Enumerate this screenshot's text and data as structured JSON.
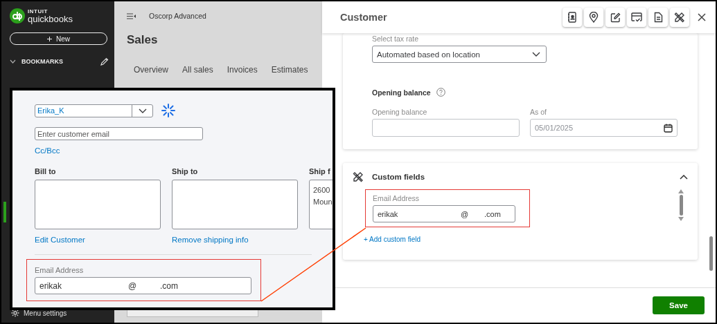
{
  "sidebar": {
    "brand_top": "INTUIT",
    "brand": "quickbooks",
    "new_button": "New",
    "bookmarks": "BOOKMARKS",
    "menu_settings": "Menu settings"
  },
  "page": {
    "company": "Oscorp Advanced",
    "title": "Sales",
    "tabs": [
      {
        "label": "Overview",
        "selected": false
      },
      {
        "label": "All sales",
        "selected": false
      },
      {
        "label": "Invoices",
        "selected": false
      },
      {
        "label": "Estimates",
        "selected": false
      }
    ]
  },
  "inset": {
    "customer": "Erika_K",
    "email_placeholder": "Enter customer email",
    "cc_bcc": "Cc/Bcc",
    "bill_to": "Bill to",
    "ship_to": "Ship to",
    "ship_from": "Ship f",
    "ship_from_lines": [
      "2600",
      "Moun"
    ],
    "edit_customer": "Edit Customer",
    "remove_shipping": "Remove shipping info",
    "email_label": "Email Address",
    "email_user": "erikak",
    "email_at": "@",
    "email_domain": ".com"
  },
  "drawer": {
    "title": "Customer",
    "tax_rate_label": "Select tax rate",
    "tax_rate": "Automated based on location",
    "opening_balance_heading": "Opening balance",
    "opening_balance_label": "Opening balance",
    "as_of_label": "As of",
    "as_of": "05/01/2025",
    "custom_fields_title": "Custom fields",
    "custom_fields_expanded": true,
    "custom_field": {
      "label": "Email Address",
      "user": "erikak",
      "at": "@",
      "domain": ".com"
    },
    "add_custom_field": "+ Add custom field",
    "save": "Save"
  }
}
